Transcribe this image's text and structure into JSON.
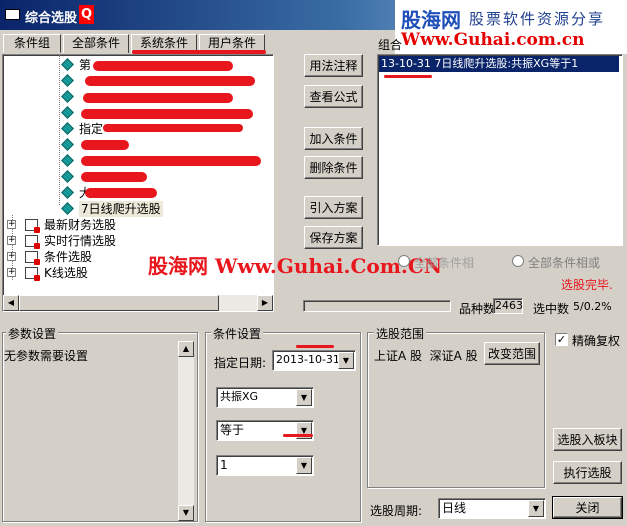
{
  "window": {
    "title": "综合选股",
    "help_glyph": "Q"
  },
  "brand": {
    "name": "股海网",
    "slogan": "股票软件资源分享",
    "url": "Www.Guhai.com.cn",
    "watermark": "股海网 Www.Guhai.Com.CN"
  },
  "tabs": [
    {
      "label": "条件组"
    },
    {
      "label": "全部条件"
    },
    {
      "label": "系统条件"
    },
    {
      "label": "用户条件"
    }
  ],
  "tree": {
    "partial_first": "第",
    "partial_item": "指定",
    "partial_last": "大",
    "selected_item": "7日线爬升选股",
    "folders": [
      {
        "label": "最新财务选股"
      },
      {
        "label": "实时行情选股"
      },
      {
        "label": "条件选股"
      },
      {
        "label": "K线选股"
      }
    ]
  },
  "buttons": {
    "usage_notes": "用法注释",
    "view_formula": "查看公式",
    "add_condition": "加入条件",
    "delete_condition": "删除条件",
    "import_scheme": "引入方案",
    "save_scheme": "保存方案",
    "change_range": "改变范围",
    "to_sector": "选股入板块",
    "run": "执行选股",
    "close": "关闭"
  },
  "combo_group": {
    "label": "组合",
    "items": [
      "13-10-31 7日线爬升选股:共振XG等于1"
    ]
  },
  "options": {
    "all_true_partial": "全部条件相",
    "all_or": "全部条件相或",
    "status": "选股完毕."
  },
  "stats": {
    "count_label": "品种数",
    "count_value": "2463",
    "selected_label": "选中数",
    "selected_value": "5/0.2%"
  },
  "params": {
    "title": "参数设置",
    "text": "无参数需要设置"
  },
  "condition": {
    "title": "条件设置",
    "date_label": "指定日期:",
    "date_value": "2013-10-31",
    "field_value": "共振XG",
    "operator_value": "等于",
    "value_value": "1"
  },
  "scope": {
    "title": "选股范围",
    "text": "上证A 股  深证A 股"
  },
  "precise": {
    "label": "精确复权",
    "check_mark": "✓"
  },
  "period": {
    "label": "选股周期:",
    "value": "日线"
  },
  "colors": {
    "accent_red": "#e8161d",
    "title_blue": "#0a246a",
    "brand_blue": "#1f4fb8",
    "selection_blue": "#0a246a"
  }
}
